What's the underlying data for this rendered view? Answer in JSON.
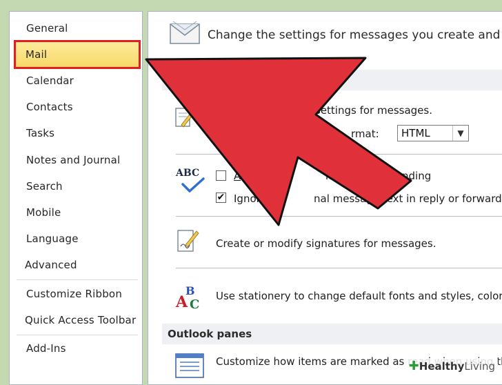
{
  "sidebar": {
    "items": [
      {
        "label": "General"
      },
      {
        "label": "Mail"
      },
      {
        "label": "Calendar"
      },
      {
        "label": "Contacts"
      },
      {
        "label": "Tasks"
      },
      {
        "label": "Notes and Journal"
      },
      {
        "label": "Search"
      },
      {
        "label": "Mobile"
      },
      {
        "label": "Language"
      },
      {
        "label": "Advanced"
      },
      {
        "label": "Customize Ribbon"
      },
      {
        "label": "Quick Access Toolbar"
      },
      {
        "label": "Add-Ins"
      }
    ],
    "active_index": 1
  },
  "main": {
    "header": "Change the settings for messages you create and r",
    "compose": {
      "line1": "settings for messages.",
      "format_label": "rmat:",
      "format_value": "HTML"
    },
    "spelling": {
      "always_check": {
        "label": "A",
        "label_tail": "k spelling b",
        "label_end": "nding",
        "checked": false
      },
      "ignore_original": {
        "label": "Ignore",
        "label_tail": "nal message text in reply or forward",
        "checked": true
      }
    },
    "signatures": "Create or modify signatures for messages.",
    "stationery": "Use stationery to change default fonts and styles, colors",
    "outlook_panes": {
      "title": "Outlook panes",
      "text": "Customize how items are marked as read when using th"
    },
    "abc_icon_text": "ABC"
  },
  "colors": {
    "accent_red": "#e0303a",
    "active_highlight": "#f8d96a",
    "highlight_border": "#e02020"
  },
  "watermark": {
    "brand": "Healthy",
    "brand2": "Living"
  }
}
